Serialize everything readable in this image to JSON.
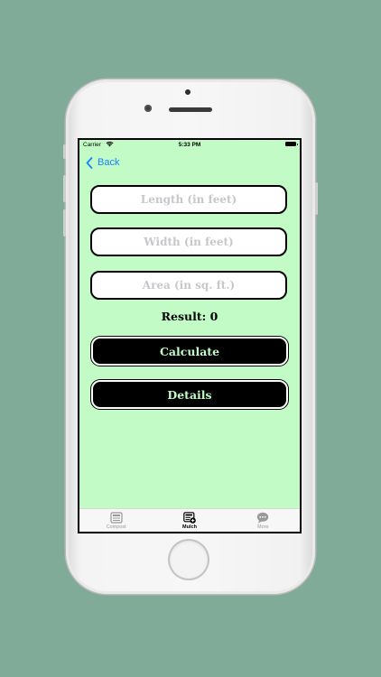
{
  "status_bar": {
    "carrier": "Carrier",
    "time": "5:33 PM",
    "wifi_icon": "wifi-icon",
    "battery_icon": "battery-icon"
  },
  "nav": {
    "back_label": "Back",
    "back_icon": "chevron-left-icon"
  },
  "form": {
    "length": {
      "placeholder": "Length (in feet)",
      "value": ""
    },
    "width": {
      "placeholder": "Width (in feet)",
      "value": ""
    },
    "area": {
      "placeholder": "Area (in sq. ft.)",
      "value": ""
    },
    "result_text": "Result: 0"
  },
  "buttons": {
    "calculate_label": "Calculate",
    "details_label": "Details"
  },
  "tab_bar": {
    "tabs": [
      {
        "label": "Compost",
        "icon": "newspaper-icon",
        "selected": false
      },
      {
        "label": "Mulch",
        "icon": "newspaper-plus-icon",
        "selected": true
      },
      {
        "label": "More",
        "icon": "chat-bubble-icon",
        "selected": false
      }
    ]
  },
  "colors": {
    "background": "#80ab98",
    "screen_background": "#c2fbc6",
    "button_background": "#000000",
    "button_text": "#c2fbc6",
    "link": "#1682ff"
  }
}
